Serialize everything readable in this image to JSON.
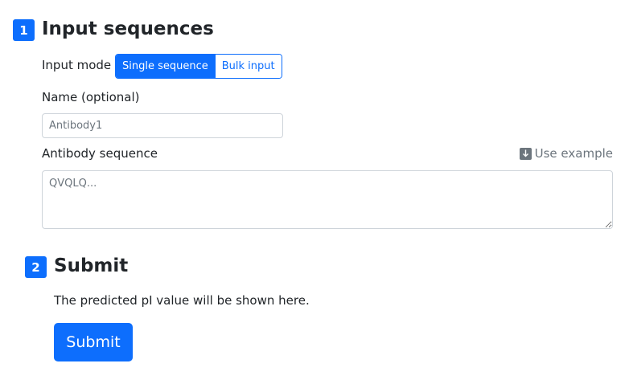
{
  "section1": {
    "number": "1",
    "title": "Input sequences",
    "input_mode_label": "Input mode",
    "mode_options": [
      "Single sequence",
      "Bulk input"
    ],
    "selected_mode": "Single sequence",
    "name_label": "Name (optional)",
    "name_placeholder": "Antibody1",
    "name_value": "",
    "sequence_label": "Antibody sequence",
    "use_example_label": "Use example",
    "sequence_placeholder": "QVQLQ...",
    "sequence_value": ""
  },
  "section2": {
    "number": "2",
    "title": "Submit",
    "description": "The predicted pI value will be shown here.",
    "submit_label": "Submit"
  },
  "colors": {
    "primary": "#0d6efd",
    "muted": "#6c757d",
    "border": "#ced4da",
    "text": "#212529"
  },
  "icons": {
    "use_example": "download-arrow-icon"
  }
}
